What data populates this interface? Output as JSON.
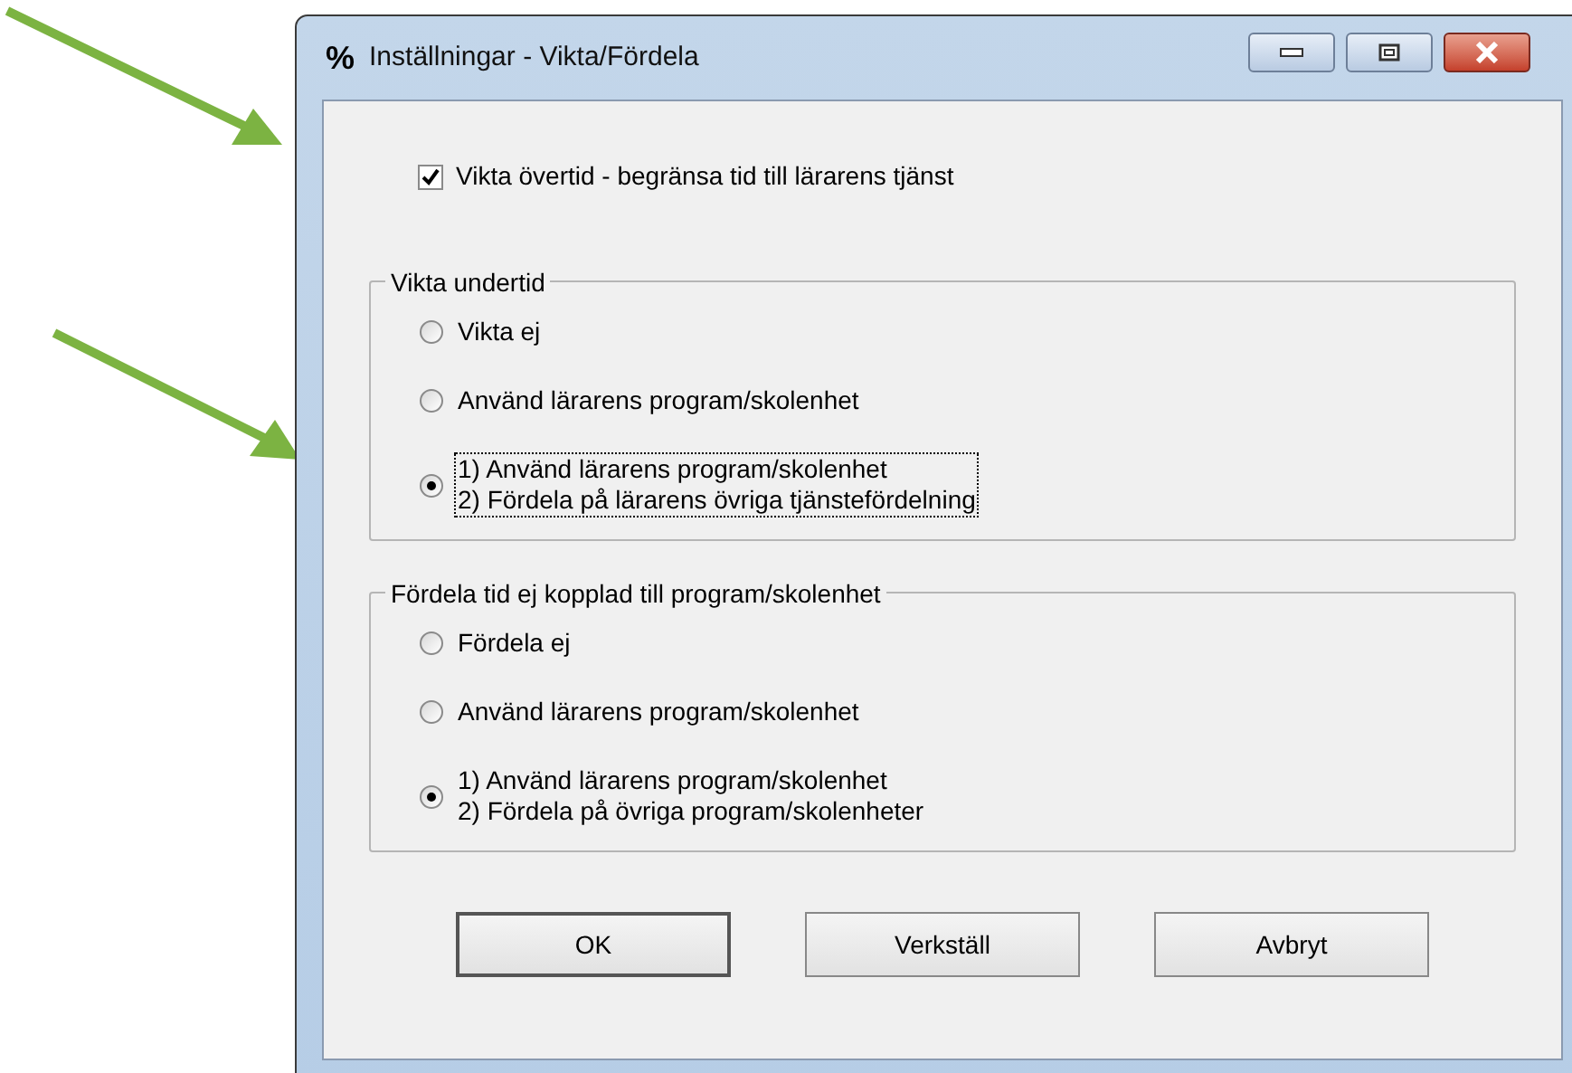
{
  "window": {
    "icon": "%",
    "title": "Inställningar - Vikta/Fördela"
  },
  "checkbox": {
    "label": "Vikta övertid - begränsa tid till lärarens tjänst",
    "checked": true
  },
  "groups": [
    {
      "title": "Vikta undertid",
      "options": [
        {
          "lines": [
            "Vikta ej"
          ],
          "selected": false,
          "focused": false
        },
        {
          "lines": [
            "Använd lärarens program/skolenhet"
          ],
          "selected": false,
          "focused": false
        },
        {
          "lines": [
            "1) Använd lärarens program/skolenhet",
            "2) Fördela på lärarens övriga tjänstefördelning"
          ],
          "selected": true,
          "focused": true
        }
      ]
    },
    {
      "title": "Fördela tid ej kopplad till program/skolenhet",
      "options": [
        {
          "lines": [
            "Fördela ej"
          ],
          "selected": false,
          "focused": false
        },
        {
          "lines": [
            "Använd lärarens program/skolenhet"
          ],
          "selected": false,
          "focused": false
        },
        {
          "lines": [
            "1) Använd lärarens program/skolenhet",
            "2) Fördela på övriga program/skolenheter"
          ],
          "selected": true,
          "focused": false
        }
      ]
    }
  ],
  "buttons": [
    {
      "label": "OK",
      "default": true
    },
    {
      "label": "Verkställ",
      "default": false
    },
    {
      "label": "Avbryt",
      "default": false
    }
  ]
}
